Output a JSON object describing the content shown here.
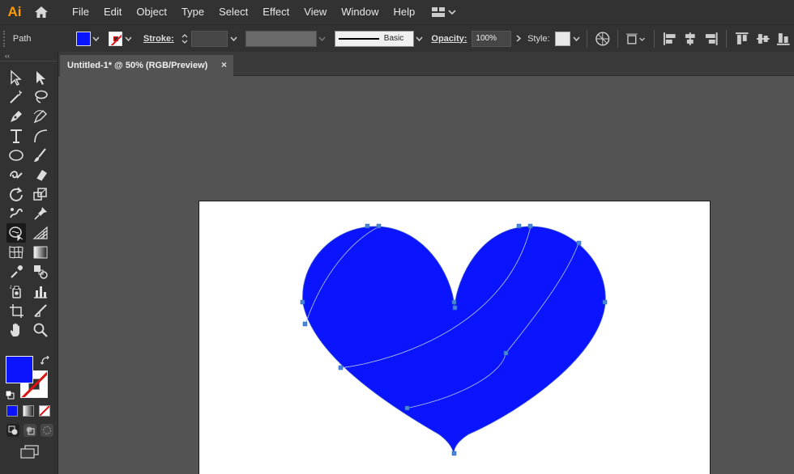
{
  "app": {
    "logo": "Ai"
  },
  "menu": [
    "File",
    "Edit",
    "Object",
    "Type",
    "Select",
    "Effect",
    "View",
    "Window",
    "Help"
  ],
  "control_bar": {
    "object_type": "Path",
    "stroke_label": "Stroke:",
    "stroke_weight": "",
    "profile_label": "Basic",
    "opacity_label": "Opacity:",
    "opacity_value": "100%",
    "style_label": "Style:"
  },
  "document": {
    "tab_title": "Untitled-1* @ 50% (RGB/Preview)",
    "close_glyph": "×"
  },
  "colors": {
    "fill": "#0a14ff",
    "stroke": "none",
    "artboard": "#ffffff",
    "pasteboard": "#535353",
    "selection": "#4a86d8"
  },
  "tools": [
    [
      "selection-tool",
      "direct-selection-tool"
    ],
    [
      "magic-wand-tool",
      "lasso-tool"
    ],
    [
      "pen-tool",
      "curvature-tool"
    ],
    [
      "type-tool",
      "arc-tool"
    ],
    [
      "ellipse-tool",
      "paintbrush-tool"
    ],
    [
      "shaper-tool",
      "eraser-tool"
    ],
    [
      "rotate-tool",
      "scale-tool"
    ],
    [
      "puppet-warp-tool",
      "pin-tool"
    ],
    [
      "envelope-warp-tool",
      "perspective-grid-tool"
    ],
    [
      "mesh-tool",
      "gradient-tool"
    ],
    [
      "eyedropper-tool",
      "blend-tool"
    ],
    [
      "symbol-sprayer-tool",
      "column-graph-tool"
    ],
    [
      "artboard-tool",
      "slice-tool"
    ],
    [
      "hand-tool",
      "zoom-tool"
    ]
  ],
  "active_tool": "envelope-warp-tool",
  "artwork": {
    "shape": "heart",
    "selected": true
  }
}
